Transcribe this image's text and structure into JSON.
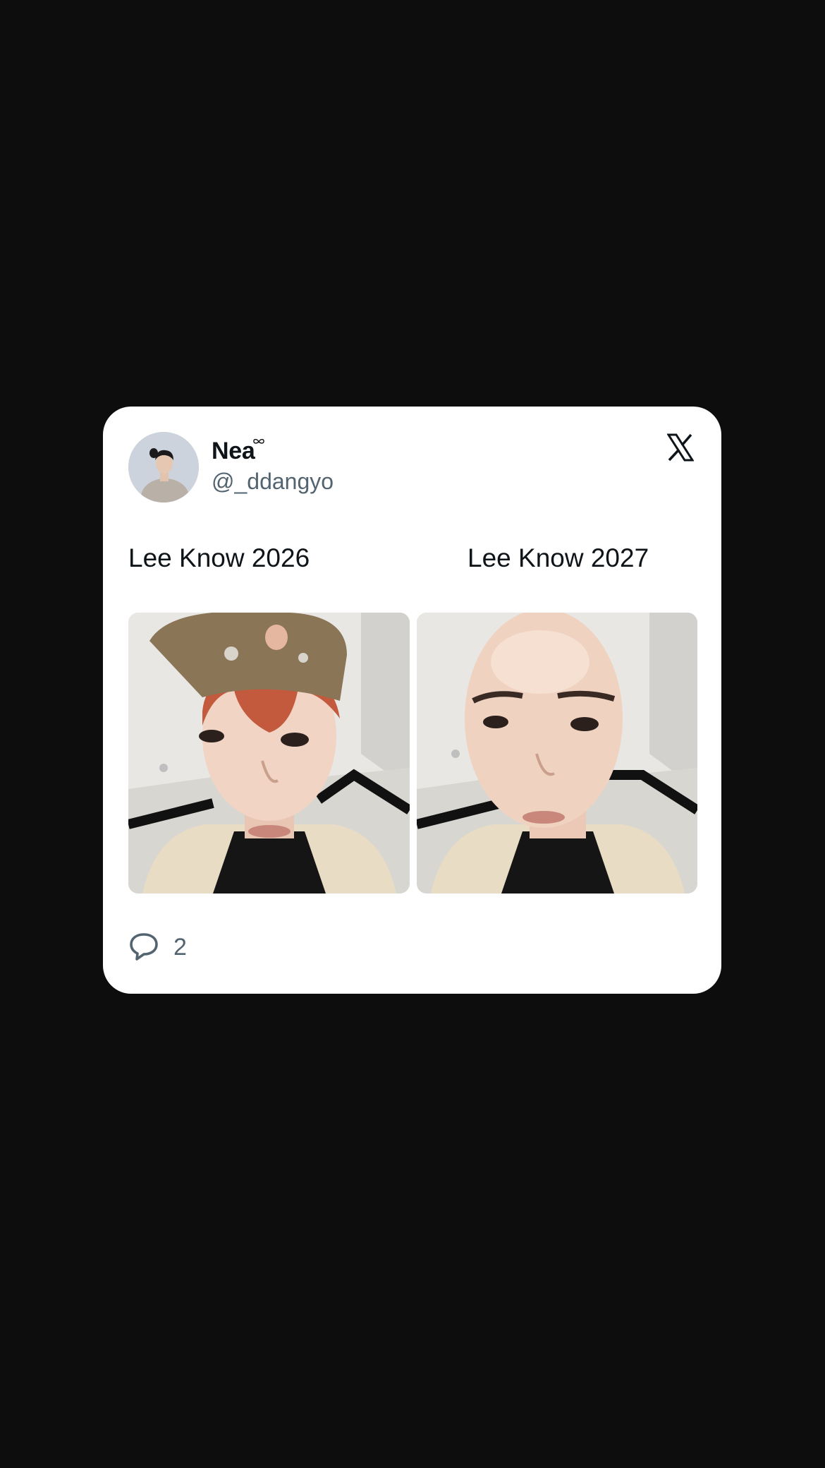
{
  "post": {
    "author": {
      "display_name": "Nea",
      "handle": "@_ddangyo",
      "avatar": "profile-photo"
    },
    "platform_icon": "x-logo-icon",
    "captions": {
      "left": "Lee Know 2026",
      "right": "Lee Know 2027"
    },
    "images": [
      {
        "name": "photo-with-cap-and-red-hair"
      },
      {
        "name": "photo-bald"
      }
    ],
    "actions": {
      "reply_icon": "speech-bubble-icon",
      "reply_count": "2"
    }
  },
  "colors": {
    "page_background": "#0d0d0d",
    "card_background": "#ffffff",
    "text_primary": "#0f1419",
    "text_secondary": "#536471"
  }
}
